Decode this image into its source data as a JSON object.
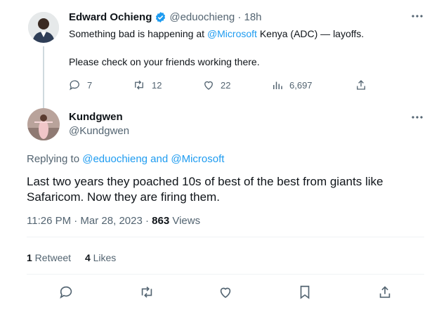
{
  "quoted_tweet": {
    "author_name": "Edward Ochieng",
    "handle_time": "@eduochieng · 18h",
    "text_prefix": "Something bad is happening at ",
    "mention": "@Microsoft",
    "text_suffix": " Kenya (ADC) — layoffs.",
    "text_line2": "Please check on your friends working there.",
    "stats": {
      "replies": "7",
      "retweets": "12",
      "likes": "22",
      "views": "6,697"
    }
  },
  "main_tweet": {
    "author_name": "Kundgwen",
    "handle": "@Kundgwen",
    "replying_prefix": "Replying to ",
    "replying_mentions": "@eduochieng and @Microsoft",
    "body_line1": "Last two years they poached 10s of  best of the best from giants like",
    "body_line2": "Safaricom. Now they are firing them.",
    "meta_time": "11:26 PM · Mar 28, 2023 · ",
    "views_count": "863",
    "views_label": " Views",
    "retweets_count": "1",
    "retweets_label": " Retweet",
    "likes_count": "4",
    "likes_label": " Likes"
  },
  "colors": {
    "accent": "#1d9bf0",
    "muted": "#536471",
    "divider": "#eff3f4"
  },
  "icons": [
    "verified-badge-icon",
    "reply-icon",
    "retweet-icon",
    "like-icon",
    "views-icon",
    "share-icon",
    "bookmark-icon",
    "more-icon"
  ]
}
